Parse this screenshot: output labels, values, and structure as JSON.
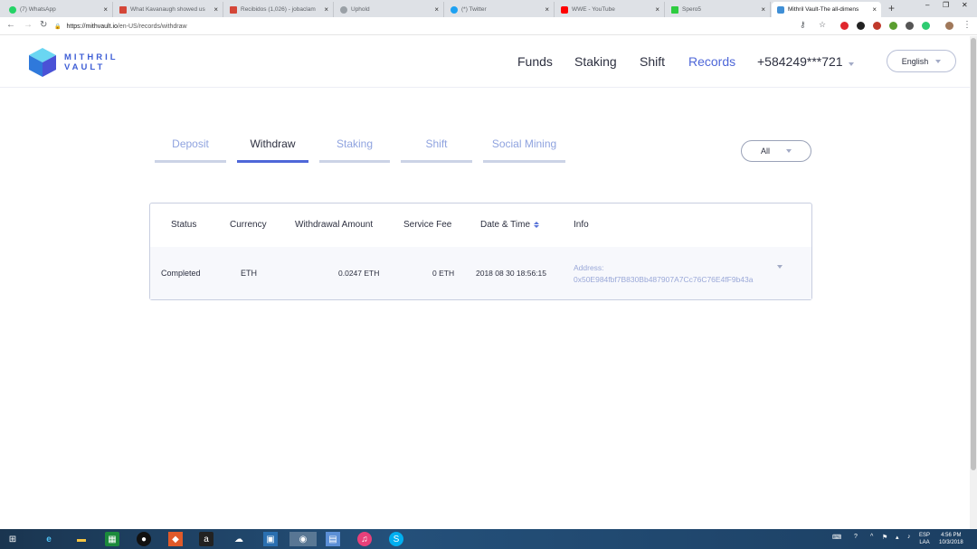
{
  "browser": {
    "tabs": [
      {
        "title": "(7) WhatsApp",
        "color": "#25d366"
      },
      {
        "title": "What Kavanaugh showed us",
        "color": "#d44638"
      },
      {
        "title": "Recibidos (1,026) - jobaclam",
        "color": "#d44638"
      },
      {
        "title": "Uphold",
        "color": "#9aa0a6"
      },
      {
        "title": "(*) Twitter",
        "color": "#1da1f2"
      },
      {
        "title": "WWE - YouTube",
        "color": "#ff0000"
      },
      {
        "title": "Spero5",
        "color": "#2ecc40"
      },
      {
        "title": "Mithril Vault-The all-dimens",
        "color": "#3f8fd6"
      }
    ],
    "url_host": "https://mithvault.io",
    "url_path": "/en-US/records/withdraw"
  },
  "header": {
    "logo_line1": "MITHRIL",
    "logo_line2": "VAULT",
    "nav": {
      "funds": "Funds",
      "staking": "Staking",
      "shift": "Shift",
      "records": "Records"
    },
    "phone": "+584249***721",
    "language": "English"
  },
  "record_tabs": {
    "deposit": "Deposit",
    "withdraw": "Withdraw",
    "staking": "Staking",
    "shift": "Shift",
    "social_mining": "Social Mining"
  },
  "filter": {
    "value": "All"
  },
  "table": {
    "headers": {
      "status": "Status",
      "currency": "Currency",
      "amount": "Withdrawal Amount",
      "fee": "Service Fee",
      "datetime": "Date & Time",
      "info": "Info"
    },
    "rows": [
      {
        "status": "Completed",
        "currency": "ETH",
        "amount": "0.0247 ETH",
        "fee": "0 ETH",
        "datetime": "2018 08 30 18:56:15",
        "info_label": "Address:",
        "info_value": "0x50E984fbf7B830Bb487907A7Cc76C76E4fF9b43a"
      }
    ]
  },
  "taskbar": {
    "lang_line1": "ESP",
    "lang_line2": "LAA",
    "time": "4:56 PM",
    "date": "10/3/2018"
  }
}
